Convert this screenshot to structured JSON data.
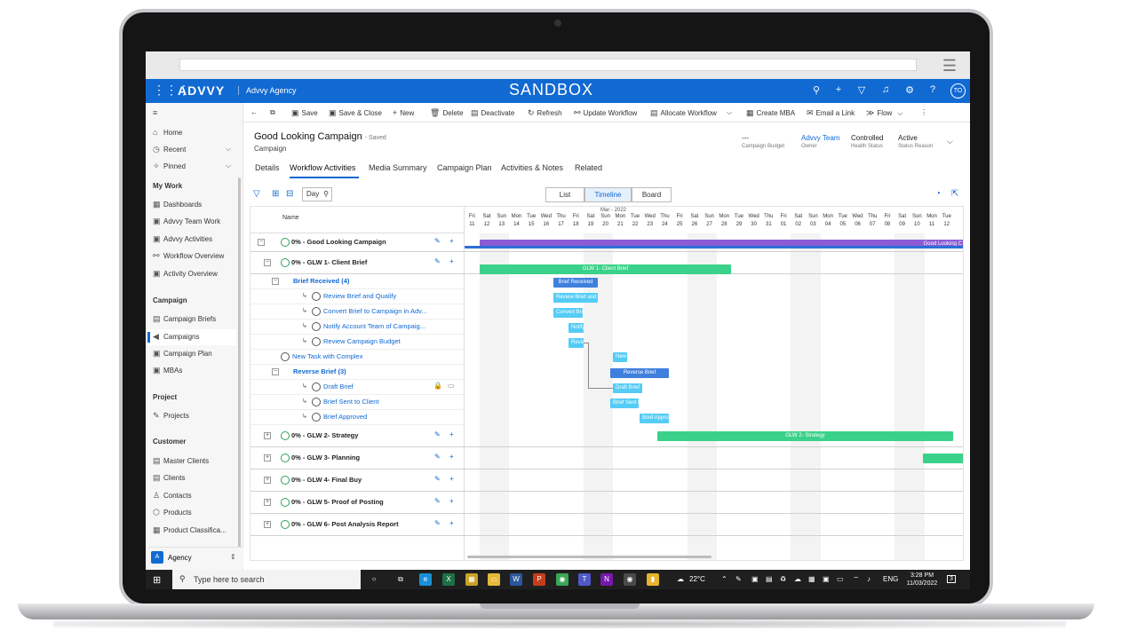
{
  "browser": {
    "menu_icon": "hamburger-icon"
  },
  "topnav": {
    "waffle": "⋮⋮⋮",
    "brand": "ADVVY",
    "org": "Advvy Agency",
    "environment": "SANDBOX",
    "avatar": "TO"
  },
  "sidebar": {
    "items": [
      {
        "label": "Home",
        "icon": "⌂"
      },
      {
        "label": "Recent",
        "icon": "◷"
      },
      {
        "label": "Pinned",
        "icon": "✧"
      }
    ],
    "groups": {
      "my_work": "My Work",
      "campaign": "Campaign",
      "project": "Project",
      "customer": "Customer"
    },
    "my_work_items": [
      "Dashboards",
      "Advvy Team Work",
      "Advvy Activities",
      "Workflow Overview",
      "Activity Overview"
    ],
    "campaign_items": [
      "Campaign Briefs",
      "Campaigns",
      "Campaign Plan",
      "MBAs"
    ],
    "project_items": [
      "Projects"
    ],
    "customer_items": [
      "Master Clients",
      "Clients",
      "Contacts",
      "Products",
      "Product Classifica..."
    ],
    "area": {
      "badge": "A",
      "label": "Agency"
    }
  },
  "commands": {
    "save": "Save",
    "save_close": "Save & Close",
    "new": "New",
    "delete": "Delete",
    "deactivate": "Deactivate",
    "refresh": "Refresh",
    "update_workflow": "Update Workflow",
    "allocate_workflow": "Allocate Workflow",
    "create_mba": "Create MBA",
    "email_link": "Email a Link",
    "flow": "Flow"
  },
  "record": {
    "title": "Good Looking Campaign",
    "saved": "- Saved",
    "entity": "Campaign",
    "budget_value": "---",
    "budget_label": "Campaign Budget",
    "owner_value": "Advvy Team",
    "owner_label": "Owner",
    "health_value": "Controlled",
    "health_label": "Health Status",
    "status_value": "Active",
    "status_label": "Status Reason"
  },
  "tabs": [
    "Details",
    "Workflow Activities",
    "Media Summary",
    "Campaign Plan",
    "Activities & Notes",
    "Related"
  ],
  "toolbar": {
    "day": "Day",
    "views": [
      "List",
      "Timeline",
      "Board"
    ]
  },
  "grid": {
    "name_header": "Name",
    "month": "Mar - 2022",
    "days": [
      [
        "Fri",
        "11"
      ],
      [
        "Sat",
        "12"
      ],
      [
        "Sun",
        "13"
      ],
      [
        "Mon",
        "14"
      ],
      [
        "Tue",
        "15"
      ],
      [
        "Wed",
        "16"
      ],
      [
        "Thu",
        "17"
      ],
      [
        "Fri",
        "18"
      ],
      [
        "Sat",
        "19"
      ],
      [
        "Sun",
        "20"
      ],
      [
        "Mon",
        "21"
      ],
      [
        "Tue",
        "22"
      ],
      [
        "Wed",
        "23"
      ],
      [
        "Thu",
        "24"
      ],
      [
        "Fri",
        "25"
      ],
      [
        "Sat",
        "26"
      ],
      [
        "Sun",
        "27"
      ],
      [
        "Mon",
        "28"
      ],
      [
        "Tue",
        "29"
      ],
      [
        "Wed",
        "30"
      ],
      [
        "Thu",
        "31"
      ],
      [
        "Fri",
        "01"
      ],
      [
        "Sat",
        "02"
      ],
      [
        "Sun",
        "03"
      ],
      [
        "Mon",
        "04"
      ],
      [
        "Tue",
        "05"
      ],
      [
        "Wed",
        "06"
      ],
      [
        "Thu",
        "07"
      ],
      [
        "Fri",
        "08"
      ],
      [
        "Sat",
        "09"
      ],
      [
        "Sun",
        "10"
      ],
      [
        "Mon",
        "11"
      ],
      [
        "Tue",
        "12"
      ]
    ],
    "rows": [
      {
        "text": "0% - Good Looking Campaign"
      },
      {
        "text": "0% - GLW 1- Client Brief"
      },
      {
        "text": "Brief Received (4)"
      },
      {
        "text": "Review Brief and Qualify"
      },
      {
        "text": "Convert Brief to Campaign in Adv..."
      },
      {
        "text": "Notify Account Team of Campaig..."
      },
      {
        "text": "Review Campaign Budget"
      },
      {
        "text": "New Task with Complex"
      },
      {
        "text": "Reverse Brief (3)"
      },
      {
        "text": "Draft Brief"
      },
      {
        "text": "Brief Sent to Client"
      },
      {
        "text": "Brief Approved"
      },
      {
        "text": "0% - GLW 2- Strategy"
      },
      {
        "text": "0% - GLW 3- Planning"
      },
      {
        "text": "0% - GLW 4- Final Buy"
      },
      {
        "text": "0% - GLW 5- Proof of Posting"
      },
      {
        "text": "0% - GLW 6- Post Analysis Report"
      }
    ],
    "bars": {
      "campaign": "Good Looking C",
      "glw1": "GLW 1- Client Brief",
      "brief_received": "Brief Received",
      "review_brief": "Review Brief and",
      "convert": "Convert Bri",
      "notify": "Notify",
      "review_budget": "Review",
      "new_task": "New",
      "reverse_brief": "Reverse Brief",
      "draft": "Draft Brief",
      "sent": "Brief Sent t",
      "approved": "Brief Appro",
      "glw2": "GLW 2- Strategy"
    }
  },
  "taskbar": {
    "search_placeholder": "Type here to search",
    "weather": "22°C",
    "lang": "ENG",
    "time": "3:28 PM",
    "date": "11/03/2022",
    "notif": "3"
  }
}
